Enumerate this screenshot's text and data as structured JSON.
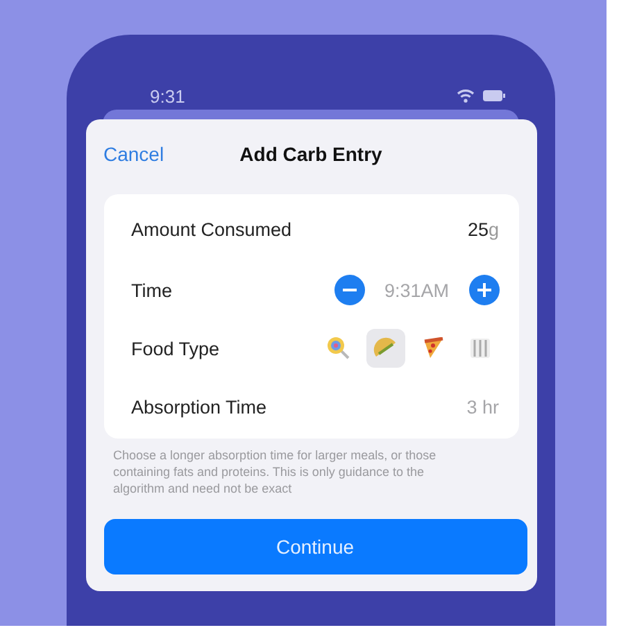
{
  "status_bar": {
    "time": "9:31"
  },
  "nav": {
    "cancel": "Cancel",
    "title": "Add Carb Entry"
  },
  "amount": {
    "label": "Amount Consumed",
    "value": "25",
    "unit": "g"
  },
  "time": {
    "label": "Time",
    "value": "9:31AM"
  },
  "food_type": {
    "label": "Food Type",
    "options": [
      {
        "kind": "lollipop",
        "selected": false
      },
      {
        "kind": "taco",
        "selected": true
      },
      {
        "kind": "pizza",
        "selected": false
      },
      {
        "kind": "plate",
        "selected": false
      }
    ]
  },
  "absorption": {
    "label": "Absorption Time",
    "value": "3 hr"
  },
  "footer_note": "Choose a longer absorption time for larger meals, or those containing fats and proteins. This is only guidance to the algorithm and need not be exact",
  "continue_button": "Continue"
}
